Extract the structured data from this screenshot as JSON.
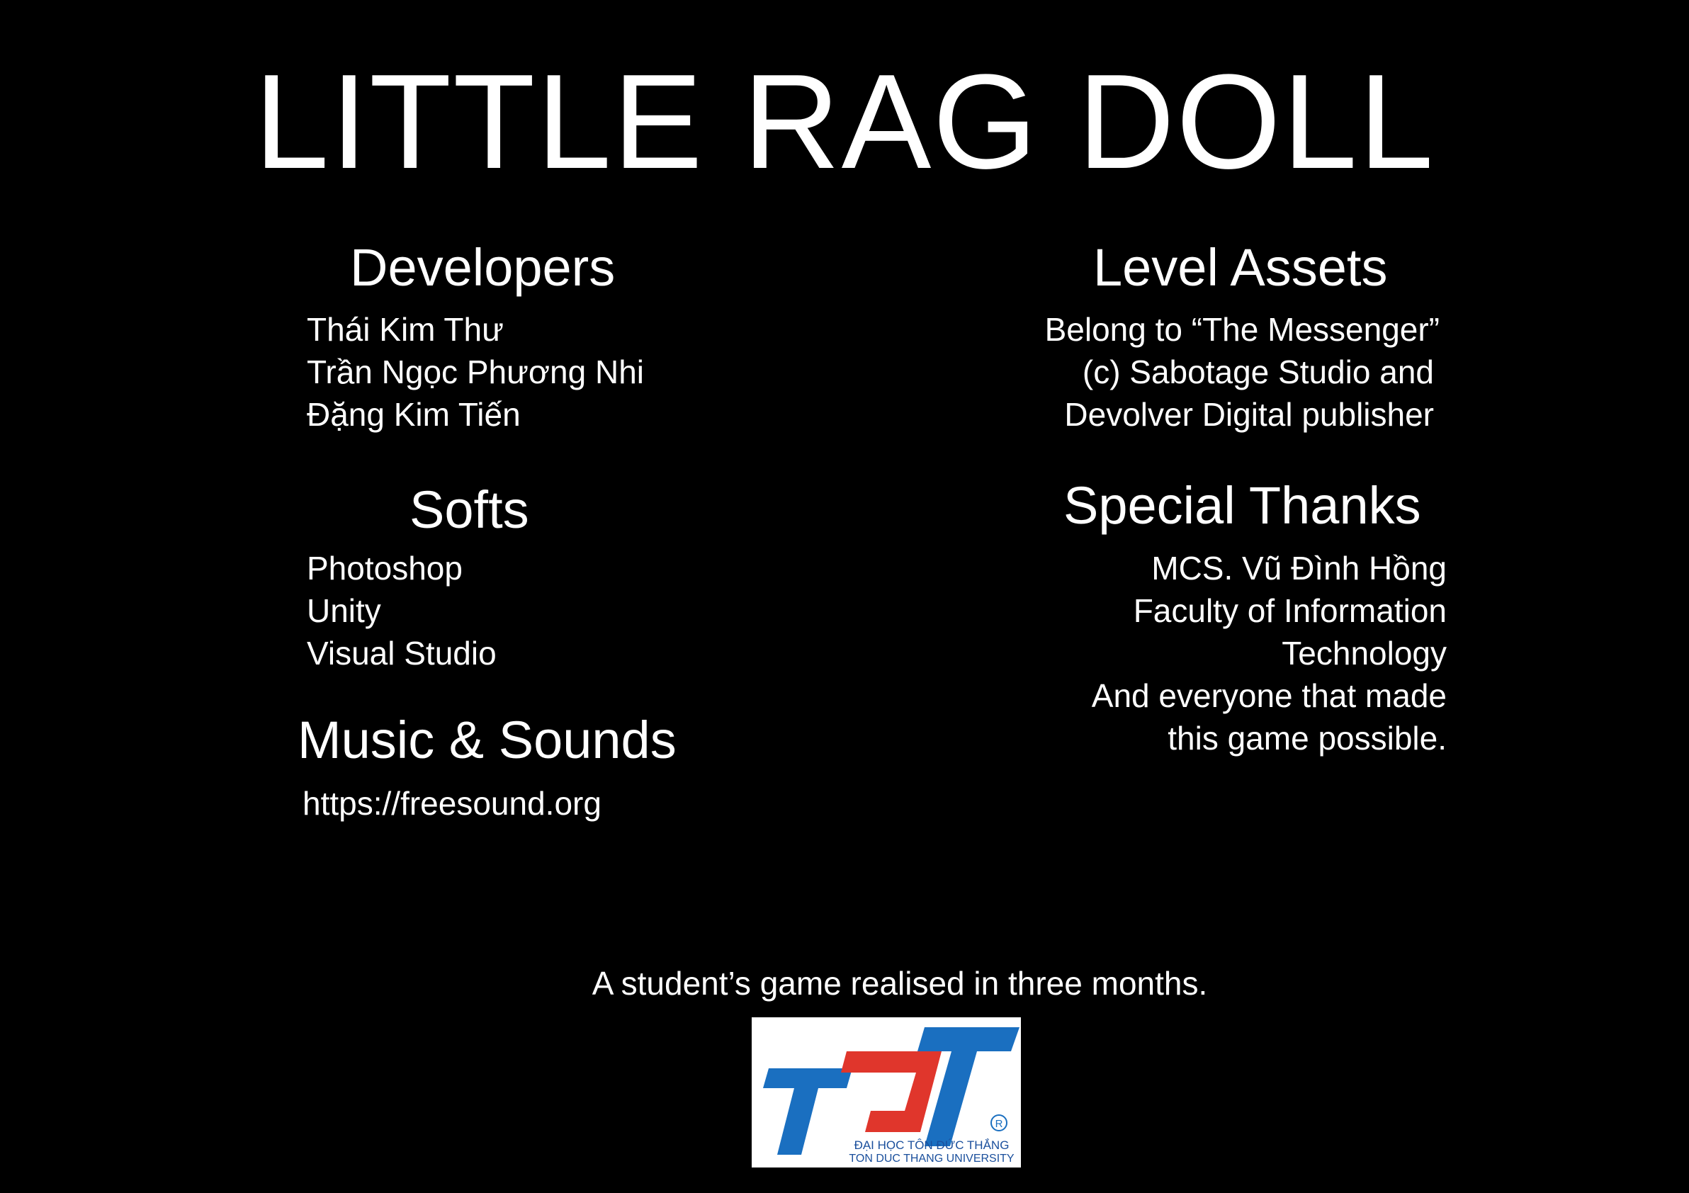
{
  "title": "LITTLE RAG DOLL",
  "developers": {
    "heading": "Developers",
    "names": [
      "Thái Kim Thư",
      "Trần Ngọc Phương Nhi",
      "Đặng Kim Tiến"
    ]
  },
  "softs": {
    "heading": "Softs",
    "items": [
      "Photoshop",
      "Unity",
      "Visual Studio"
    ]
  },
  "music": {
    "heading": "Music & Sounds",
    "source": "https://freesound.org"
  },
  "level_assets": {
    "heading": "Level Assets",
    "lines": [
      "Belong to “The Messenger”",
      "(c) Sabotage Studio and",
      "Devolver Digital publisher"
    ]
  },
  "special_thanks": {
    "heading": "Special Thanks",
    "lines": [
      "MCS. Vũ Đình Hồng",
      "Faculty of Information",
      "Technology",
      "And everyone that made",
      "this game possible."
    ]
  },
  "footer": {
    "tagline": "A student’s game realised in three months."
  },
  "logo": {
    "mark": "TDT",
    "name_vi": "ĐẠI HỌC TÔN ĐỨC THẮNG",
    "name_en": "TON DUC THANG UNIVERSITY",
    "registered": "®",
    "colors": {
      "blue": "#1a6fc0",
      "red": "#e0362c"
    }
  }
}
